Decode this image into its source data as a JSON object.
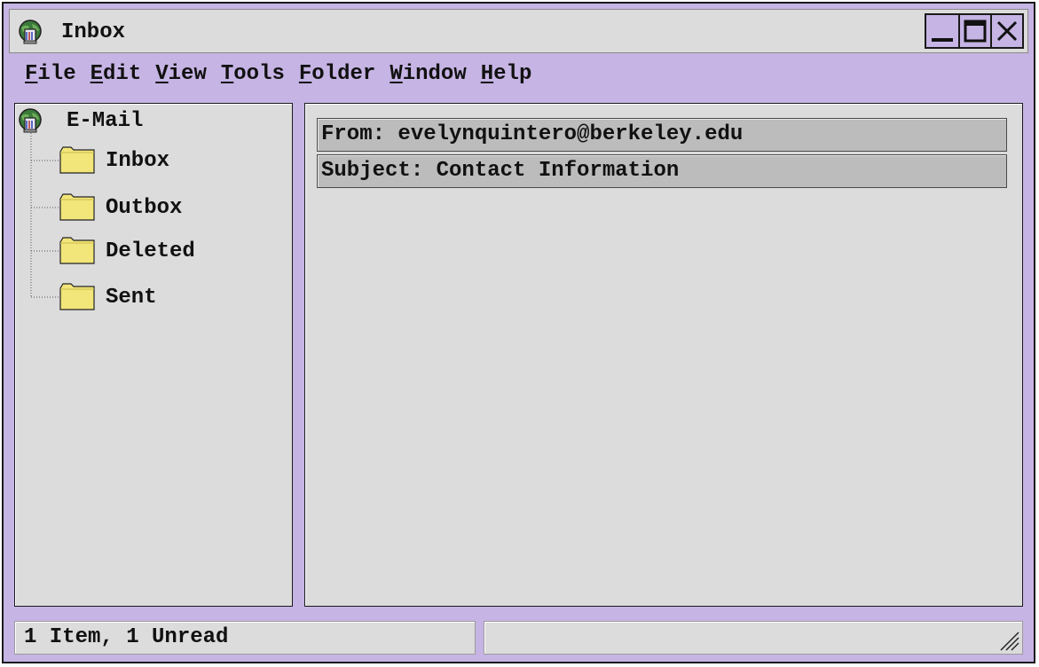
{
  "window": {
    "title": "Inbox",
    "controls": {
      "minimize": "minimize-icon",
      "maximize": "maximize-icon",
      "close": "close-icon"
    }
  },
  "menu": {
    "items": [
      {
        "accel": "F",
        "rest": "ile"
      },
      {
        "accel": "E",
        "rest": "dit"
      },
      {
        "accel": "V",
        "rest": "iew"
      },
      {
        "accel": "T",
        "rest": "ools"
      },
      {
        "accel": "F",
        "rest": "older"
      },
      {
        "accel": "W",
        "rest": "indow"
      },
      {
        "accel": "H",
        "rest": "elp"
      }
    ]
  },
  "tree": {
    "root_label": "E-Mail",
    "root_icon": "mail-globe-icon",
    "folders": [
      {
        "label": "Inbox",
        "icon": "folder-icon"
      },
      {
        "label": "Outbox",
        "icon": "folder-icon"
      },
      {
        "label": "Deleted",
        "icon": "folder-icon"
      },
      {
        "label": "Sent",
        "icon": "folder-icon"
      }
    ]
  },
  "message": {
    "from": "From: evelynquintero@berkeley.edu",
    "subject": "Subject: Contact Information"
  },
  "status": {
    "summary": "1 Item, 1 Unread",
    "right": ""
  },
  "colors": {
    "frame": "#c6b4e4",
    "panel": "#dcdcdc",
    "header_field": "#bcbcbc",
    "folder": "#f2e67a",
    "border": "#1a1a1a"
  }
}
